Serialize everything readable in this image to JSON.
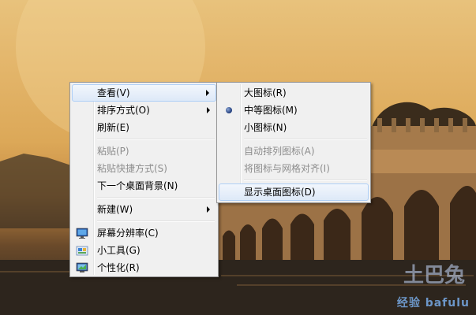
{
  "context_menu": {
    "items": [
      {
        "label": "查看(V)"
      },
      {
        "label": "排序方式(O)"
      },
      {
        "label": "刷新(E)"
      },
      {
        "label": "粘贴(P)"
      },
      {
        "label": "粘贴快捷方式(S)"
      },
      {
        "label": "下一个桌面背景(N)"
      },
      {
        "label": "新建(W)"
      },
      {
        "label": "屏幕分辨率(C)",
        "icon": "display-resolution-icon"
      },
      {
        "label": "小工具(G)",
        "icon": "gadgets-icon"
      },
      {
        "label": "个性化(R)",
        "icon": "personalize-icon"
      }
    ]
  },
  "view_submenu": {
    "items": [
      {
        "label": "大图标(R)"
      },
      {
        "label": "中等图标(M)",
        "selected": true
      },
      {
        "label": "小图标(N)"
      },
      {
        "label": "自动排列图标(A)"
      },
      {
        "label": "将图标与网格对齐(I)"
      },
      {
        "label": "显示桌面图标(D)"
      }
    ]
  },
  "watermark": {
    "text": "经验 bafulu",
    "logo_text": "土巴兔"
  },
  "colors": {
    "menu_bg": "#f0f0f0",
    "highlight_border": "#aecff7",
    "disabled_text": "#8d8d8d"
  }
}
